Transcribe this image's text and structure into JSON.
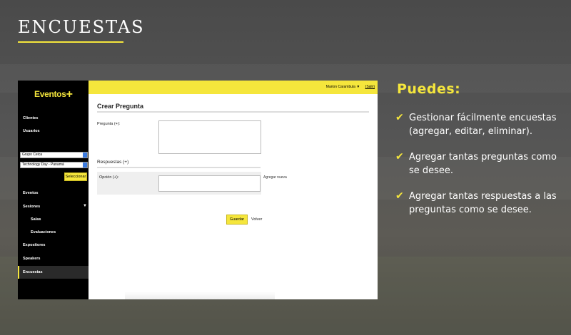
{
  "slide": {
    "title": "ENCUESTAS",
    "panel_title": "Puedes:",
    "bullets": [
      "Gestionar fácilmente encuestas (agregar, editar, eliminar).",
      "Agregar tantas preguntas como se desee.",
      "Agregar tantas respuestas a las preguntas como se desee."
    ]
  },
  "app": {
    "logo_text": "Eventos",
    "logo_plus": "+",
    "user": {
      "name": "Marion Carambula ▼",
      "logout": "(Salir)"
    },
    "sidebar": {
      "items_top": [
        "Clientes",
        "Usuarios"
      ],
      "client_select": "Grupo Ceica",
      "event_select": "Technology Day - Panamá",
      "select_button": "Seleccionar",
      "menu": {
        "eventos": "Eventos",
        "sesiones": "Sesiones",
        "salas": "Salas",
        "evaluaciones": "Evaluaciones",
        "expositores": "Expositores",
        "speakers": "Speakers",
        "encuestas": "Encuestas"
      }
    },
    "form": {
      "title": "Crear Pregunta",
      "question_label": "Pregunta (+):",
      "question_value": "",
      "answers_title": "Respuestas (+)",
      "option_label": "Opción (+):",
      "option_value": "",
      "add_new": "Agregar nueva",
      "save": "Guardar",
      "back": "Volver"
    }
  },
  "colors": {
    "accent": "#f5e63c",
    "sidebar_bg": "#000000",
    "text_white": "#ffffff"
  }
}
